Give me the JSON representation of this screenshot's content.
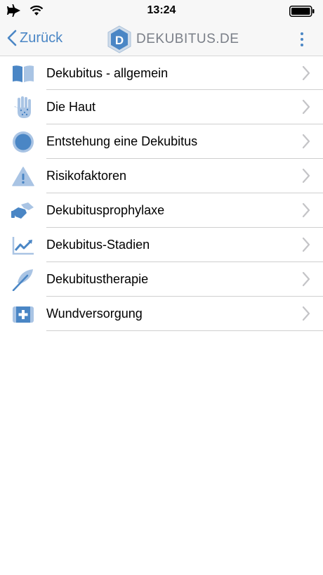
{
  "status_bar": {
    "time": "13:24",
    "icons": [
      "airplane-icon",
      "wifi-icon",
      "battery-icon"
    ]
  },
  "nav_bar": {
    "back_label": "Zurück",
    "logo_letter": "D",
    "logo_text": "DEKUBITUS.DE",
    "accent_color": "#4a86c5"
  },
  "menu": {
    "items": [
      {
        "label": "Dekubitus - allgemein",
        "icon": "book-icon"
      },
      {
        "label": "Die Haut",
        "icon": "hand-icon"
      },
      {
        "label": "Entstehung eine Dekubitus",
        "icon": "circle-icon"
      },
      {
        "label": "Risikofaktoren",
        "icon": "warning-icon"
      },
      {
        "label": "Dekubitusprophylaxe",
        "icon": "handshake-icon"
      },
      {
        "label": "Dekubitus-Stadien",
        "icon": "chart-icon"
      },
      {
        "label": "Dekubitustherapie",
        "icon": "feather-icon"
      },
      {
        "label": "Wundversorgung",
        "icon": "first-aid-icon"
      }
    ]
  }
}
